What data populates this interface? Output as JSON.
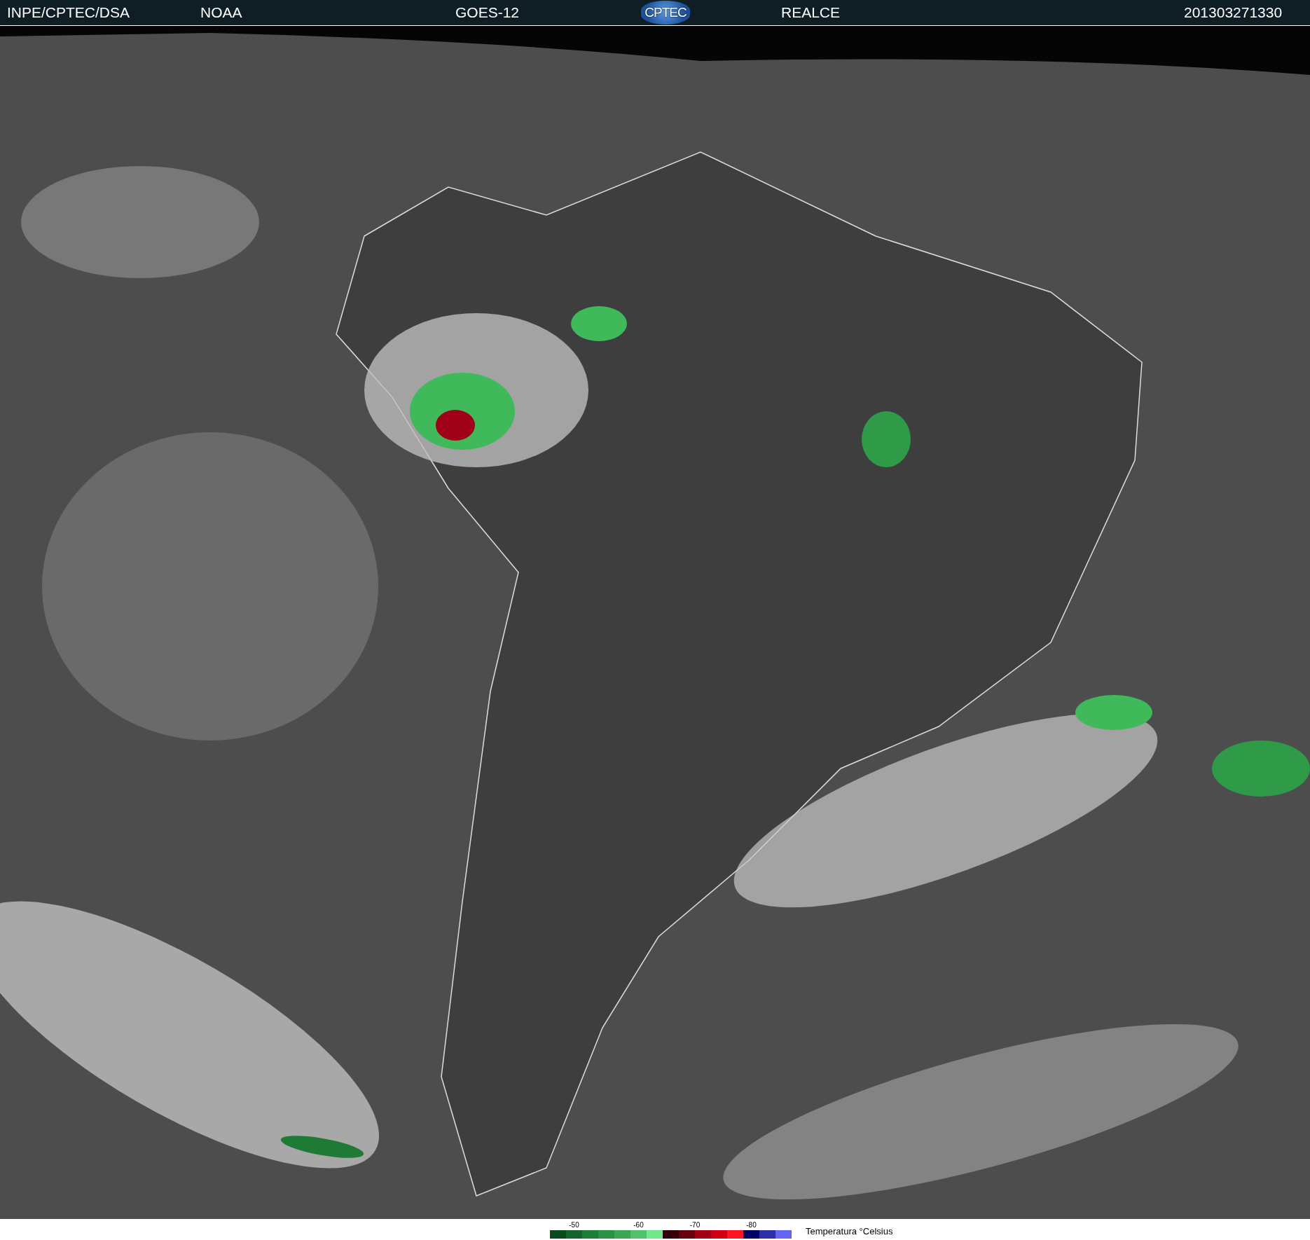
{
  "header": {
    "items": [
      {
        "kind": "text",
        "text": "INPE/CPTEC/DSA"
      },
      {
        "kind": "text",
        "text": "NOAA"
      },
      {
        "kind": "text",
        "text": "GOES-12"
      },
      {
        "kind": "logo",
        "text": "CPTEC"
      },
      {
        "kind": "text",
        "text": "REALCE"
      },
      {
        "kind": "text",
        "text": "201303271330"
      }
    ]
  },
  "legend": {
    "ticks": [
      "-50",
      "-60",
      "-70",
      "-80"
    ],
    "segments": [
      {
        "color": "#0b4a1c"
      },
      {
        "color": "#15652b"
      },
      {
        "color": "#1e7d36"
      },
      {
        "color": "#299345"
      },
      {
        "color": "#38a854"
      },
      {
        "color": "#52c26a"
      },
      {
        "color": "#70e98b"
      },
      {
        "color": "#35000a"
      },
      {
        "color": "#680010"
      },
      {
        "color": "#a00014"
      },
      {
        "color": "#d00014"
      },
      {
        "color": "#ff1424"
      },
      {
        "color": "#000066"
      },
      {
        "color": "#2e2ea6"
      },
      {
        "color": "#6464f2"
      }
    ],
    "title": "Temperatura °Celsius"
  }
}
